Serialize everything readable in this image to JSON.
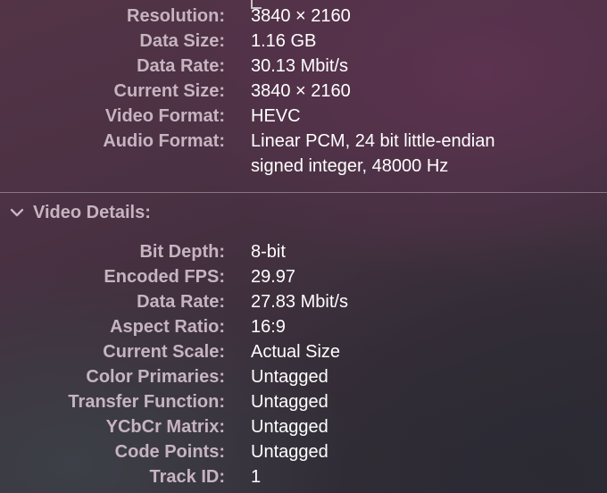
{
  "general": {
    "rows": [
      {
        "label": "Resolution:",
        "value": "3840 × 2160"
      },
      {
        "label": "Data Size:",
        "value": "1.16 GB"
      },
      {
        "label": "Data Rate:",
        "value": "30.13 Mbit/s"
      },
      {
        "label": "Current Size:",
        "value": "3840 × 2160"
      },
      {
        "label": "Video Format:",
        "value": "HEVC"
      },
      {
        "label": "Audio Format:",
        "value": "Linear PCM, 24 bit little-endian",
        "value_line2": "signed integer, 48000 Hz"
      }
    ]
  },
  "video_details": {
    "title": "Video Details:",
    "toggle_icon": "chevron-down-icon",
    "rows": [
      {
        "label": "Bit Depth:",
        "value": "8-bit"
      },
      {
        "label": "Encoded FPS:",
        "value": "29.97"
      },
      {
        "label": "Data Rate:",
        "value": "27.83 Mbit/s"
      },
      {
        "label": "Aspect Ratio:",
        "value": "16:9"
      },
      {
        "label": "Current Scale:",
        "value": "Actual Size"
      },
      {
        "label": "Color Primaries:",
        "value": "Untagged"
      },
      {
        "label": "Transfer Function:",
        "value": "Untagged"
      },
      {
        "label": "YCbCr Matrix:",
        "value": "Untagged"
      },
      {
        "label": "Code Points:",
        "value": "Untagged"
      },
      {
        "label": "Track ID:",
        "value": "1"
      }
    ]
  },
  "colors": {
    "label": "#c6b4c0",
    "value": "#ffffff",
    "divider": "#8a7585"
  }
}
